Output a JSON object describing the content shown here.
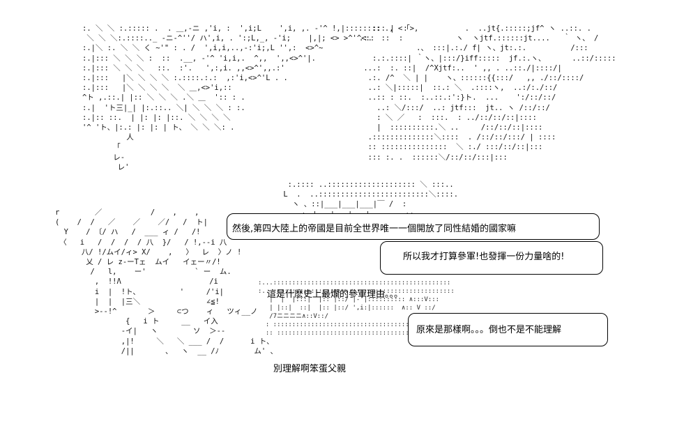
{
  "dialogue": {
    "line1": "然後,第四大陸上的帝國是目前全世界唯一一個開放了同性結婚的國家嘛",
    "line2": "所以我才打算參軍!也發揮一份力量啥的!",
    "line3": "這是什麽史上最爛的參軍理由。。。",
    "line4": "原來是那樣啊。。。倒也不是不能理解",
    "line5": "別理解啊笨蛋父親"
  }
}
